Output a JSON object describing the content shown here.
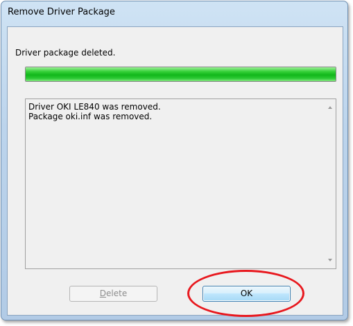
{
  "window": {
    "title": "Remove Driver Package"
  },
  "status": {
    "text": "Driver package deleted."
  },
  "progress": {
    "fraction": 1.0
  },
  "log": {
    "lines": [
      "Driver OKI LE840 was removed.",
      "Package oki.inf was removed."
    ]
  },
  "buttons": {
    "delete_label": "Delete",
    "ok_label": "OK"
  },
  "colors": {
    "progress_green": "#11b71a",
    "annotation_red": "#e8181e",
    "ok_border": "#3c7fb1"
  }
}
